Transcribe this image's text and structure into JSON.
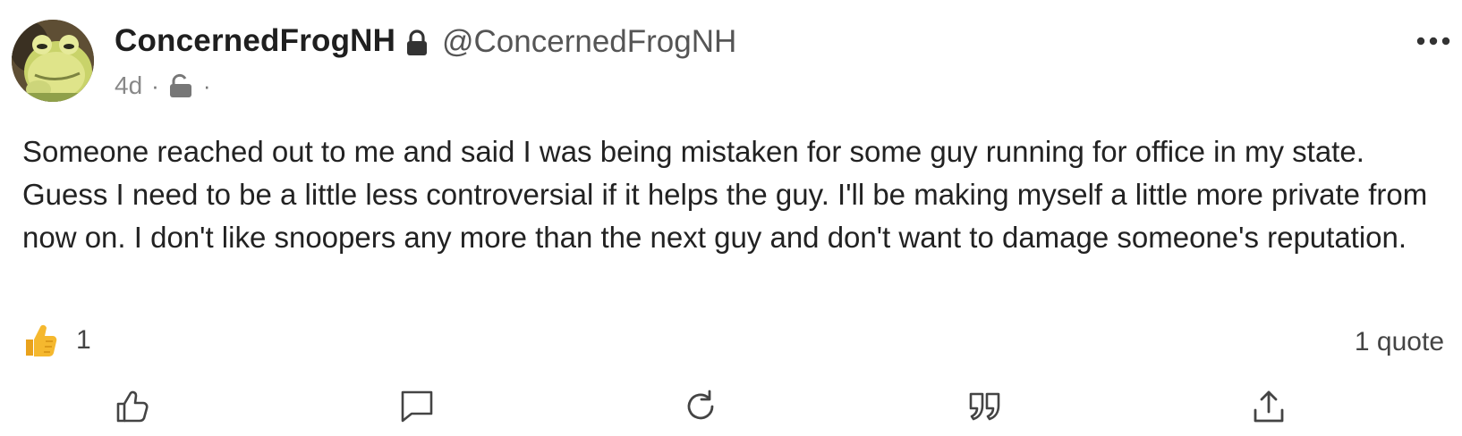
{
  "post": {
    "author": {
      "display_name": "ConcernedFrogNH",
      "handle": "@ConcernedFrogNH",
      "avatar_icon": "frog-avatar",
      "account_lock_icon": "lock-icon"
    },
    "meta": {
      "age": "4d",
      "separator": "·",
      "visibility_icon": "unlock-icon"
    },
    "content": "Someone reached out to me and said I was being mistaken for some guy running for office in my state. Guess I need to be a little less controversial if it helps the guy. I'll be making myself a little more private from now on. I don't like snoopers any more than the next guy and don't want to damage someone's reputation.",
    "reactions": {
      "emoji": "thumbs-up",
      "count": "1"
    },
    "quotes": {
      "label": "1 quote"
    },
    "actions": [
      {
        "name": "like",
        "icon": "thumbs-up-outline-icon"
      },
      {
        "name": "reply",
        "icon": "comment-icon"
      },
      {
        "name": "repost",
        "icon": "repost-icon"
      },
      {
        "name": "quote",
        "icon": "quote-icon"
      },
      {
        "name": "share",
        "icon": "share-icon"
      }
    ]
  },
  "colors": {
    "text": "#222222",
    "muted": "#888888",
    "icon": "#444444",
    "reaction_yellow": "#f5b82e"
  }
}
